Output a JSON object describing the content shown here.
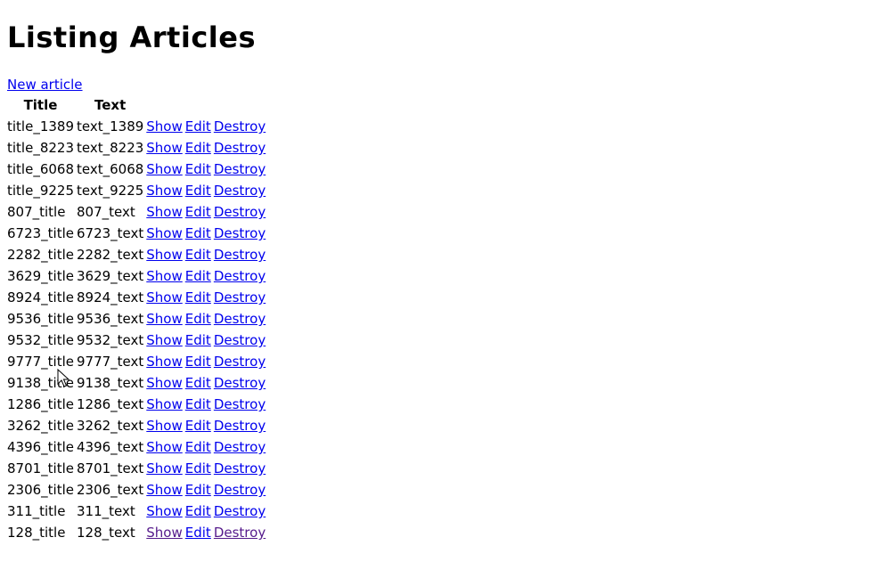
{
  "page": {
    "heading": "Listing Articles",
    "new_link": "New article"
  },
  "table": {
    "headers": [
      "Title",
      "Text"
    ],
    "action_labels": {
      "show": "Show",
      "edit": "Edit",
      "destroy": "Destroy"
    },
    "rows": [
      {
        "title": "title_1389",
        "text": "text_1389",
        "visited": false
      },
      {
        "title": "title_8223",
        "text": "text_8223",
        "visited": false
      },
      {
        "title": "title_6068",
        "text": "text_6068",
        "visited": false
      },
      {
        "title": "title_9225",
        "text": "text_9225",
        "visited": false
      },
      {
        "title": "807_title",
        "text": "807_text",
        "visited": false
      },
      {
        "title": "6723_title",
        "text": "6723_text",
        "visited": false
      },
      {
        "title": "2282_title",
        "text": "2282_text",
        "visited": false
      },
      {
        "title": "3629_title",
        "text": "3629_text",
        "visited": false
      },
      {
        "title": "8924_title",
        "text": "8924_text",
        "visited": false
      },
      {
        "title": "9536_title",
        "text": "9536_text",
        "visited": false
      },
      {
        "title": "9532_title",
        "text": "9532_text",
        "visited": false
      },
      {
        "title": "9777_title",
        "text": "9777_text",
        "visited": false
      },
      {
        "title": "9138_title",
        "text": "9138_text",
        "visited": false
      },
      {
        "title": "1286_title",
        "text": "1286_text",
        "visited": false
      },
      {
        "title": "3262_title",
        "text": "3262_text",
        "visited": false
      },
      {
        "title": "4396_title",
        "text": "4396_text",
        "visited": false
      },
      {
        "title": "8701_title",
        "text": "8701_text",
        "visited": false
      },
      {
        "title": "2306_title",
        "text": "2306_text",
        "visited": false
      },
      {
        "title": "311_title",
        "text": "311_text",
        "visited": false
      },
      {
        "title": "128_title",
        "text": "128_text",
        "visited": true
      }
    ]
  },
  "colors": {
    "link": "#0000ee",
    "visited_link": "#551a8b"
  }
}
